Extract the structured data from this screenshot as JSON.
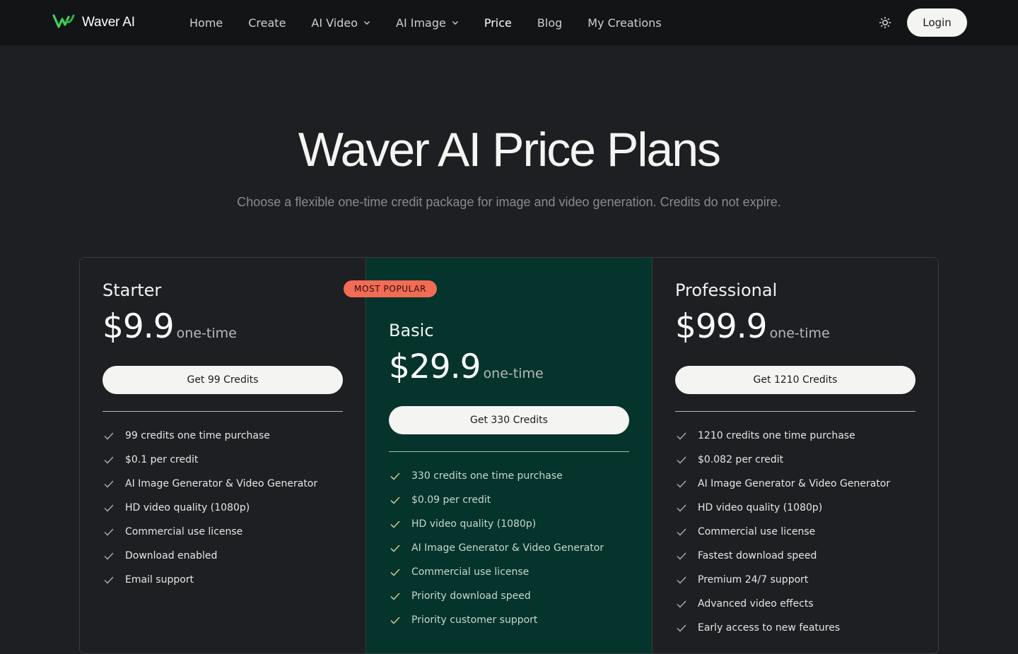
{
  "header": {
    "brand": "Waver AI",
    "nav": [
      {
        "label": "Home"
      },
      {
        "label": "Create"
      },
      {
        "label": "AI Video",
        "dropdown": true
      },
      {
        "label": "AI Image",
        "dropdown": true
      },
      {
        "label": "Price",
        "active": true
      },
      {
        "label": "Blog"
      },
      {
        "label": "My Creations"
      }
    ],
    "login_label": "Login"
  },
  "hero": {
    "title": "Waver AI Price Plans",
    "subtitle": "Choose a flexible one-time credit package for image and video generation. Credits do not expire."
  },
  "plans": [
    {
      "name": "Starter",
      "price": "$9.9",
      "unit": "one-time",
      "cta": "Get 99 Credits",
      "features": [
        "99 credits one time purchase",
        "$0.1 per credit",
        "AI Image Generator & Video Generator",
        "HD video quality (1080p)",
        "Commercial use license",
        "Download enabled",
        "Email support"
      ]
    },
    {
      "name": "Basic",
      "badge": "MOST POPULAR",
      "price": "$29.9",
      "unit": "one-time",
      "cta": "Get 330 Credits",
      "features": [
        "330 credits one time purchase",
        "$0.09 per credit",
        "HD video quality (1080p)",
        "AI Image Generator & Video Generator",
        "Commercial use license",
        "Priority download speed",
        "Priority customer support"
      ]
    },
    {
      "name": "Professional",
      "price": "$99.9",
      "unit": "one-time",
      "cta": "Get 1210 Credits",
      "features": [
        "1210 credits one time purchase",
        "$0.082 per credit",
        "AI Image Generator & Video Generator",
        "HD video quality (1080p)",
        "Commercial use license",
        "Fastest download speed",
        "Premium 24/7 support",
        "Advanced video effects",
        "Early access to new features"
      ]
    }
  ],
  "colors": {
    "background": "#1e1f22",
    "nav_background": "#131416",
    "featured_plan": "#04342b",
    "badge": "#f26b55",
    "brand_green": "#3ecf5a"
  }
}
